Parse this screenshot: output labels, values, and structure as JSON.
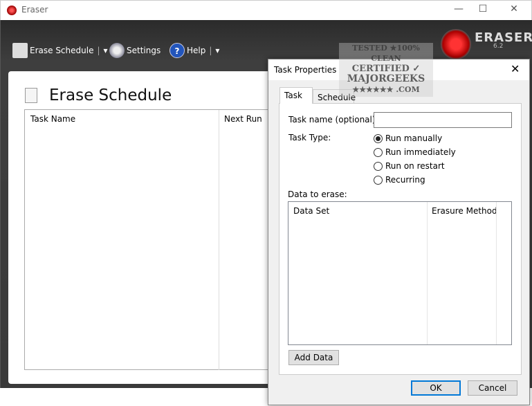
{
  "window": {
    "title": "Eraser",
    "minimize": "—",
    "maximize": "☐",
    "close": "✕"
  },
  "toolbar": {
    "erase_schedule": "Erase Schedule",
    "settings": "Settings",
    "help": "Help",
    "dropdown": "▾"
  },
  "logo": {
    "name": "ERASER",
    "version": "6.2"
  },
  "watermark": {
    "line1": "TESTED ★100% CLEAN",
    "line2": "CERTIFIED ✓",
    "line3": "MAJORGEEKS",
    "line4": "★★★★★★ .COM"
  },
  "schedule": {
    "title": "Erase Schedule",
    "columns": [
      "Task Name",
      "Next Run"
    ]
  },
  "dialog": {
    "title": "Task Properties",
    "close": "✕",
    "tabs": [
      "Task",
      "Schedule"
    ],
    "task_name_label": "Task name (optional):",
    "task_name_value": "",
    "task_type_label": "Task Type:",
    "task_types": [
      {
        "label": "Run manually",
        "selected": true
      },
      {
        "label": "Run immediately",
        "selected": false
      },
      {
        "label": "Run on restart",
        "selected": false
      },
      {
        "label": "Recurring",
        "selected": false
      }
    ],
    "data_label": "Data to erase:",
    "columns": [
      "Data Set",
      "Erasure Method"
    ],
    "add_data": "Add Data",
    "ok": "OK",
    "cancel": "Cancel"
  }
}
